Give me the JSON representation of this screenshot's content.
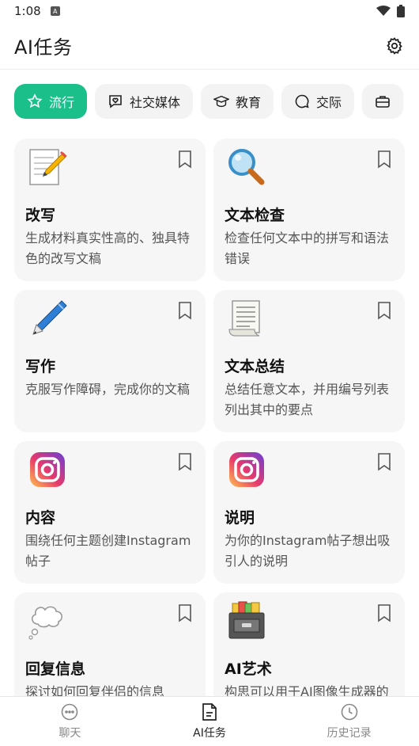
{
  "status": {
    "time": "1:08"
  },
  "header": {
    "title": "AI任务"
  },
  "chips": [
    {
      "label": "流行",
      "icon": "star-icon",
      "active": true
    },
    {
      "label": "社交媒体",
      "icon": "heart-chat-icon",
      "active": false
    },
    {
      "label": "教育",
      "icon": "graduation-cap-icon",
      "active": false
    },
    {
      "label": "交际",
      "icon": "chat-bubble-icon",
      "active": false
    },
    {
      "label": "",
      "icon": "briefcase-icon",
      "active": false
    }
  ],
  "cards": [
    {
      "title": "改写",
      "desc": "生成材料真实性高的、独具特色的改写文稿",
      "icon": "memo-pencil-icon"
    },
    {
      "title": "文本检查",
      "desc": "检查任何文本中的拼写和语法错误",
      "icon": "magnifier-icon"
    },
    {
      "title": "写作",
      "desc": "克服写作障碍，完成你的文稿",
      "icon": "pen-icon"
    },
    {
      "title": "文本总结",
      "desc": "总结任意文本，并用编号列表列出其中的要点",
      "icon": "scroll-icon"
    },
    {
      "title": "内容",
      "desc": "围绕任何主题创建Instagram帖子",
      "icon": "instagram-icon"
    },
    {
      "title": "说明",
      "desc": "为你的Instagram帖子想出吸引人的说明",
      "icon": "instagram-icon"
    },
    {
      "title": "回复信息",
      "desc": "探讨如何回复伴侣的信息",
      "icon": "thought-bubble-icon"
    },
    {
      "title": "AI艺术",
      "desc": "构思可以用于AI图像生成器的进行提示",
      "icon": "file-cabinet-icon"
    }
  ],
  "nav": [
    {
      "label": "聊天",
      "icon": "chat-icon",
      "active": false
    },
    {
      "label": "AI任务",
      "icon": "document-icon",
      "active": true
    },
    {
      "label": "历史记录",
      "icon": "clock-icon",
      "active": false
    }
  ],
  "colors": {
    "accent": "#1bbf8a",
    "card_bg": "#f6f6f6",
    "chip_bg": "#f3f3f3"
  }
}
